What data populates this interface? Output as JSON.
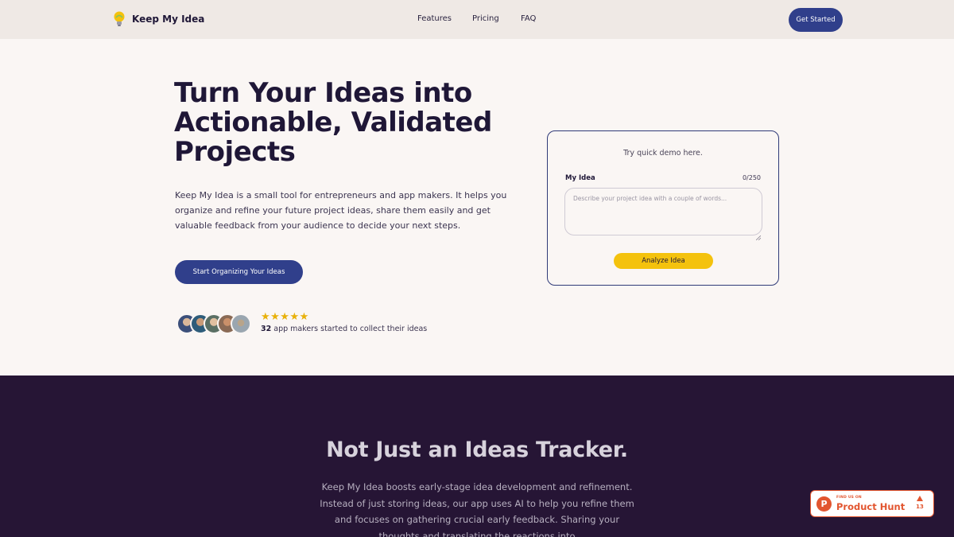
{
  "header": {
    "brand": "Keep My Idea",
    "logo_icon": "lightbulb-icon",
    "nav": [
      {
        "label": "Features"
      },
      {
        "label": "Pricing"
      },
      {
        "label": "FAQ"
      }
    ],
    "cta_label": "Get Started"
  },
  "hero": {
    "title": "Turn Your Ideas into Actionable, Validated Projects",
    "description": "Keep My Idea is a small tool for entrepreneurs and app makers. It helps you organize and refine your future project ideas, share them easily and get valuable feedback from your audience to decide your next steps.",
    "cta_label": "Start Organizing Your Ideas",
    "rating_stars": "★★★★★",
    "rating_value": 5,
    "maker_count": "32",
    "maker_text": " app makers started to collect their ideas"
  },
  "demo": {
    "prompt": "Try quick demo here.",
    "field_label": "My Idea",
    "char_count": "0/250",
    "input_value": "",
    "input_placeholder": "Describe your project idea with a couple of words...",
    "button_label": "Analyze Idea"
  },
  "section2": {
    "title": "Not Just an Ideas Tracker.",
    "description": "Keep My Idea boosts early-stage idea development and refinement. Instead of just storing ideas, our app uses AI to help you refine them and focuses on gathering crucial early feedback. Sharing your thoughts and translating the reactions into"
  },
  "product_hunt": {
    "small_label": "FIND US ON",
    "big_label": "Product Hunt",
    "letter": "P",
    "upvotes": "13"
  },
  "colors": {
    "primary": "#303f8b",
    "accent_yellow": "#f4c20d",
    "dark_bg": "#261535",
    "header_bg": "#efe9e5",
    "page_bg": "#faf6f4",
    "producthunt": "#e2552f"
  }
}
